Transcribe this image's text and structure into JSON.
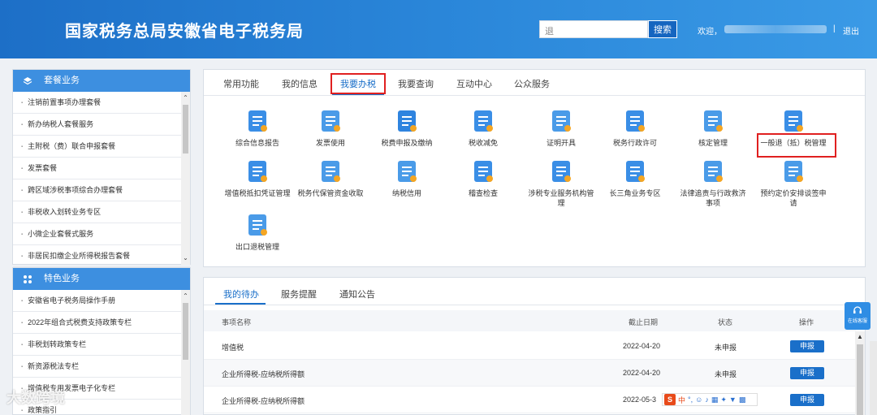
{
  "header": {
    "title": "国家税务总局安徽省电子税务局",
    "search_value": "退",
    "search_button": "搜索",
    "welcome": "欢迎，",
    "separator": "|",
    "logout": "退出"
  },
  "sidebar": {
    "package": {
      "title": "套餐业务",
      "items": [
        "注销前置事项办理套餐",
        "新办纳税人套餐服务",
        "主附税（费）联合申报套餐",
        "发票套餐",
        "跨区域涉税事项综合办理套餐",
        "非税收入划转业务专区",
        "小微企业套餐式服务",
        "非居民扣缴企业所得税报告套餐"
      ]
    },
    "special": {
      "title": "特色业务",
      "items": [
        "安徽省电子税务局操作手册",
        "2022年组合式税费支持政策专栏",
        "非税划转政策专栏",
        "新资源税法专栏",
        "增值税专用发票电子化专栏",
        "政策指引"
      ]
    }
  },
  "main": {
    "tabs": [
      "常用功能",
      "我的信息",
      "我要办税",
      "我要查询",
      "互动中心",
      "公众服务"
    ],
    "active_tab": "我要办税",
    "grid": [
      {
        "label": "综合信息报告",
        "icon": "doc-list-icon"
      },
      {
        "label": "发票使用",
        "icon": "invoice-icon"
      },
      {
        "label": "税费申报及缴纳",
        "icon": "tax-declare-icon"
      },
      {
        "label": "税收减免",
        "icon": "tax-relief-icon"
      },
      {
        "label": "证明开具",
        "icon": "certificate-icon"
      },
      {
        "label": "税务行政许可",
        "icon": "chart-icon"
      },
      {
        "label": "核定管理",
        "icon": "approve-icon"
      },
      {
        "label": "一般退（抵）税管理",
        "icon": "refund-icon"
      },
      {
        "label": "增值税抵扣凭证管理",
        "icon": "vat-voucher-icon"
      },
      {
        "label": "税务代保管资金收取",
        "icon": "custody-icon"
      },
      {
        "label": "纳税信用",
        "icon": "credit-icon"
      },
      {
        "label": "稽查检查",
        "icon": "inspection-icon"
      },
      {
        "label": "涉税专业服务机构管理",
        "icon": "agency-icon"
      },
      {
        "label": "长三角业务专区",
        "icon": "delta-icon"
      },
      {
        "label": "法律追责与行政救济事项",
        "icon": "legal-icon"
      },
      {
        "label": "预约定价安排谈签申请",
        "icon": "pricing-icon"
      },
      {
        "label": "出口退税管理",
        "icon": "export-refund-icon"
      }
    ]
  },
  "todo": {
    "tabs": [
      "我的待办",
      "服务提醒",
      "通知公告"
    ],
    "columns": [
      "事项名称",
      "截止日期",
      "状态",
      "操作"
    ],
    "rows": [
      {
        "name": "增值税",
        "deadline": "2022-04-20",
        "status": "未申报",
        "action": "申报"
      },
      {
        "name": "企业所得税-应纳税所得额",
        "deadline": "2022-04-20",
        "status": "未申报",
        "action": "申报"
      },
      {
        "name": "企业所得税-应纳税所得额",
        "deadline": "2022-05-3",
        "status": "",
        "action": "申报"
      }
    ]
  },
  "ime": {
    "logo": "S",
    "lang": "中"
  },
  "float": {
    "label": "在线客服"
  },
  "watermark": "大数跨境",
  "colors": {
    "header": "#2a86d9",
    "accent": "#1a6fc9",
    "highlight": "#e02020"
  }
}
